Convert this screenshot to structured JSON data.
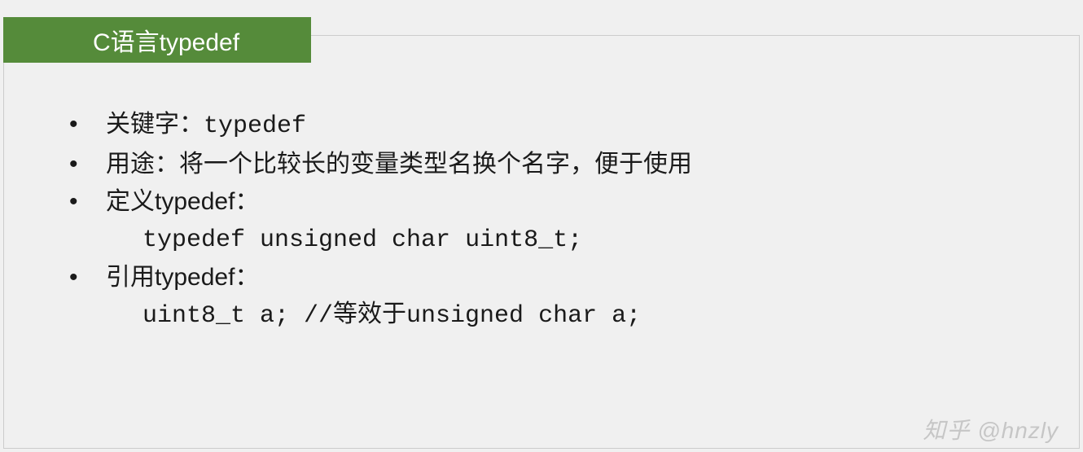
{
  "title": "C语言typedef",
  "bullets": [
    {
      "label": "关键字：",
      "value": "typedef"
    },
    {
      "label": "用途：将一个比较长的变量类型名换个名字，便于使用",
      "value": ""
    },
    {
      "label": "定义typedef：",
      "code": "typedef unsigned char uint8_t;"
    },
    {
      "label": "引用typedef：",
      "code": "uint8_t a;   //等效于unsigned char a;"
    }
  ],
  "watermark": "知乎 @hnzly"
}
